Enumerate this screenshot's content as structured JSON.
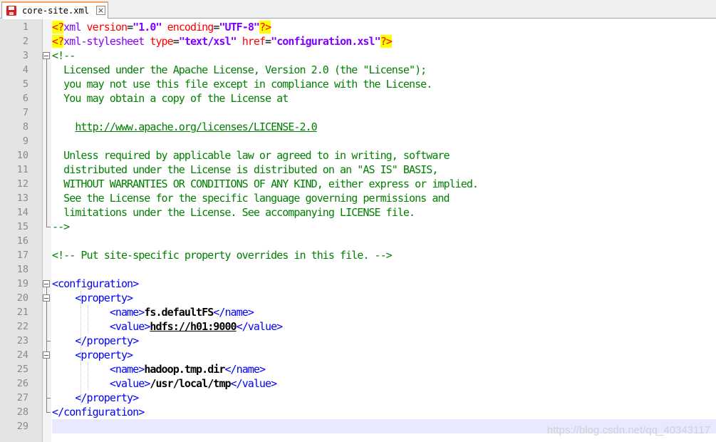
{
  "tab": {
    "label": "core-site.xml",
    "close_glyph": "×",
    "icon": "save-icon"
  },
  "lines": [
    {
      "n": "1",
      "tokens": [
        [
          "pi",
          "<?"
        ],
        [
          "name",
          "xml "
        ],
        [
          "attr",
          "version"
        ],
        [
          "plain",
          "="
        ],
        [
          "str",
          "\"1.0\""
        ],
        [
          "plain",
          " "
        ],
        [
          "attr",
          "encoding"
        ],
        [
          "plain",
          "="
        ],
        [
          "str",
          "\"UTF-8\""
        ],
        [
          "pi",
          "?>"
        ]
      ]
    },
    {
      "n": "2",
      "tokens": [
        [
          "pi",
          "<?"
        ],
        [
          "name",
          "xml-stylesheet "
        ],
        [
          "attr",
          "type"
        ],
        [
          "plain",
          "="
        ],
        [
          "str",
          "\"text/xsl\""
        ],
        [
          "plain",
          " "
        ],
        [
          "attr",
          "href"
        ],
        [
          "plain",
          "="
        ],
        [
          "str",
          "\"configuration.xsl\""
        ],
        [
          "pi",
          "?>"
        ]
      ]
    },
    {
      "n": "3",
      "tokens": [
        [
          "cmt",
          "<!--"
        ]
      ]
    },
    {
      "n": "4",
      "tokens": [
        [
          "cmt",
          "  Licensed under the Apache License, Version 2.0 (the \"License\");"
        ]
      ]
    },
    {
      "n": "5",
      "tokens": [
        [
          "cmt",
          "  you may not use this file except in compliance with the License."
        ]
      ]
    },
    {
      "n": "6",
      "tokens": [
        [
          "cmt",
          "  You may obtain a copy of the License at"
        ]
      ]
    },
    {
      "n": "7",
      "tokens": []
    },
    {
      "n": "8",
      "tokens": [
        [
          "cmt",
          "    "
        ],
        [
          "url",
          "http://www.apache.org/licenses/LICENSE-2.0"
        ]
      ]
    },
    {
      "n": "9",
      "tokens": []
    },
    {
      "n": "10",
      "tokens": [
        [
          "cmt",
          "  Unless required by applicable law or agreed to in writing, software"
        ]
      ]
    },
    {
      "n": "11",
      "tokens": [
        [
          "cmt",
          "  distributed under the License is distributed on an \"AS IS\" BASIS,"
        ]
      ]
    },
    {
      "n": "12",
      "tokens": [
        [
          "cmt",
          "  WITHOUT WARRANTIES OR CONDITIONS OF ANY KIND, either express or implied."
        ]
      ]
    },
    {
      "n": "13",
      "tokens": [
        [
          "cmt",
          "  See the License for the specific language governing permissions and"
        ]
      ]
    },
    {
      "n": "14",
      "tokens": [
        [
          "cmt",
          "  limitations under the License. See accompanying LICENSE file."
        ]
      ]
    },
    {
      "n": "15",
      "tokens": [
        [
          "cmt",
          "-->"
        ]
      ]
    },
    {
      "n": "16",
      "tokens": []
    },
    {
      "n": "17",
      "tokens": [
        [
          "cmt",
          "<!-- Put site-specific property overrides in this file. -->"
        ]
      ]
    },
    {
      "n": "18",
      "tokens": []
    },
    {
      "n": "19",
      "tokens": [
        [
          "tag",
          "<configuration>"
        ]
      ]
    },
    {
      "n": "20",
      "tokens": [
        [
          "plain",
          "    "
        ],
        [
          "tag",
          "<property>"
        ]
      ]
    },
    {
      "n": "21",
      "tokens": [
        [
          "plain",
          "          "
        ],
        [
          "tag",
          "<name>"
        ],
        [
          "txt",
          "fs.defaultFS"
        ],
        [
          "tag",
          "</name>"
        ]
      ]
    },
    {
      "n": "22",
      "tokens": [
        [
          "plain",
          "          "
        ],
        [
          "tag",
          "<value>"
        ],
        [
          "txtu",
          "hdfs://h01:9000"
        ],
        [
          "tag",
          "</value>"
        ]
      ]
    },
    {
      "n": "23",
      "tokens": [
        [
          "plain",
          "    "
        ],
        [
          "tag",
          "</property>"
        ]
      ]
    },
    {
      "n": "24",
      "tokens": [
        [
          "plain",
          "    "
        ],
        [
          "tag",
          "<property>"
        ]
      ]
    },
    {
      "n": "25",
      "tokens": [
        [
          "plain",
          "          "
        ],
        [
          "tag",
          "<name>"
        ],
        [
          "txt",
          "hadoop.tmp.dir"
        ],
        [
          "tag",
          "</name>"
        ]
      ]
    },
    {
      "n": "26",
      "tokens": [
        [
          "plain",
          "          "
        ],
        [
          "tag",
          "<value>"
        ],
        [
          "txt",
          "/usr/local/tmp"
        ],
        [
          "tag",
          "</value>"
        ]
      ]
    },
    {
      "n": "27",
      "tokens": [
        [
          "plain",
          "    "
        ],
        [
          "tag",
          "</property>"
        ]
      ]
    },
    {
      "n": "28",
      "tokens": [
        [
          "tag",
          "</configuration>"
        ]
      ]
    },
    {
      "n": "29",
      "tokens": []
    }
  ],
  "current_line": "29",
  "watermark": "https://blog.csdn.net/qq_40343117",
  "colors": {
    "tag": "#0000ff",
    "comment": "#008000",
    "attr": "#ff0000",
    "string": "#8000ff",
    "pi_bg": "#ffff00"
  }
}
